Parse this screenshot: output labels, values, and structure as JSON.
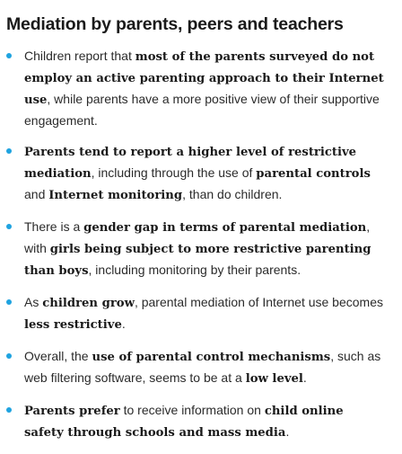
{
  "heading": "Mediation by parents, peers and teachers",
  "bullet_color": "#1fa3e0",
  "items": [
    {
      "segments": [
        {
          "t": "Children report that ",
          "b": false
        },
        {
          "t": "most of the parents surveyed do not employ an active parenting approach to their Internet use",
          "b": true
        },
        {
          "t": ", while parents have a more positive view of their supportive engagement.",
          "b": false
        }
      ]
    },
    {
      "segments": [
        {
          "t": "Parents tend to report a higher level of restrictive mediation",
          "b": true
        },
        {
          "t": ", including through the use of ",
          "b": false
        },
        {
          "t": "parental controls",
          "b": true
        },
        {
          "t": " and ",
          "b": false
        },
        {
          "t": "Internet monitoring",
          "b": true
        },
        {
          "t": ", than do children.",
          "b": false
        }
      ]
    },
    {
      "segments": [
        {
          "t": "There is a ",
          "b": false
        },
        {
          "t": "gender gap in terms of parental mediation",
          "b": true
        },
        {
          "t": ", with ",
          "b": false
        },
        {
          "t": "girls being subject to more restrictive parenting than boys",
          "b": true
        },
        {
          "t": ", including monitoring by their parents.",
          "b": false
        }
      ]
    },
    {
      "segments": [
        {
          "t": "As ",
          "b": false
        },
        {
          "t": "children grow",
          "b": true
        },
        {
          "t": ", parental mediation of Internet use becomes ",
          "b": false
        },
        {
          "t": "less restrictive",
          "b": true
        },
        {
          "t": ".",
          "b": false
        }
      ]
    },
    {
      "segments": [
        {
          "t": "Overall, the ",
          "b": false
        },
        {
          "t": "use of parental control mechanisms",
          "b": true
        },
        {
          "t": ", such as web filtering software, seems to be at a ",
          "b": false
        },
        {
          "t": "low level",
          "b": true
        },
        {
          "t": ".",
          "b": false
        }
      ]
    },
    {
      "segments": [
        {
          "t": "Parents prefer",
          "b": true
        },
        {
          "t": " to receive information on ",
          "b": false
        },
        {
          "t": "child online safety through schools and mass media",
          "b": true
        },
        {
          "t": ".",
          "b": false
        }
      ]
    }
  ]
}
